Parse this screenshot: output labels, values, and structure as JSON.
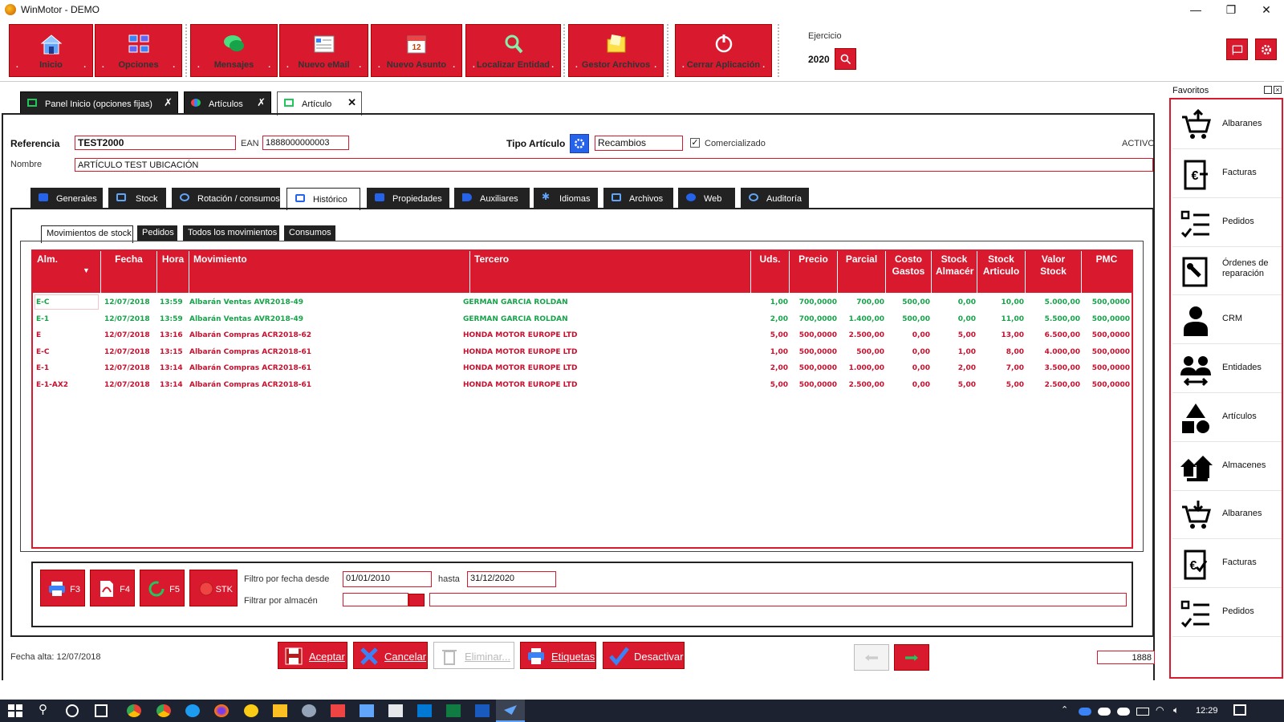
{
  "window": {
    "title": "WinMotor - DEMO",
    "min": "—",
    "max": "❐",
    "close": "✕"
  },
  "toolbar": {
    "buttons": [
      "Inicio",
      "Opciones",
      "Mensajes",
      "Nuevo eMail",
      "Nuevo Asunto",
      "Localizar Entidad",
      "Gestor Archivos",
      "Cerrar Aplicación"
    ]
  },
  "ejercicio": {
    "label": "Ejercicio",
    "value": "2020"
  },
  "favoritos": {
    "title": "Favoritos",
    "items": [
      "Albaranes",
      "Facturas",
      "Pedidos",
      "Órdenes de reparación",
      "CRM",
      "Entidades",
      "Artículos",
      "Almacenes",
      "Albaranes",
      "Facturas",
      "Pedidos"
    ]
  },
  "doc_tabs": [
    {
      "label": "Panel Inicio (opciones fijas)",
      "close": "✗"
    },
    {
      "label": "Artículos",
      "close": "✗"
    },
    {
      "label": "Artículo",
      "close": "✕"
    }
  ],
  "header": {
    "referencia_label": "Referencia",
    "referencia": "TEST2000",
    "ean_label": "EAN",
    "ean": "1888000000003",
    "tipo_label": "Tipo Artículo",
    "tipo": "Recambios",
    "comercializado_label": "Comercializado",
    "comercializado_mark": "✓",
    "estado": "ACTIVO",
    "nombre_label": "Nombre",
    "nombre": "ARTÍCULO TEST UBICACIÓN"
  },
  "sections": [
    "Generales",
    "Stock",
    "Rotación / consumos",
    "Histórico",
    "Propiedades",
    "Auxiliares",
    "Idiomas",
    "Archivos",
    "Web",
    "Auditoría"
  ],
  "hist_tabs": [
    "Movimientos de stock",
    "Pedidos",
    "Todos los movimientos",
    "Consumos"
  ],
  "grid": {
    "columns": [
      "Alm.",
      "Fecha",
      "Hora",
      "Movimiento",
      "Tercero",
      "Uds.",
      "Precio",
      "Parcial",
      "Costo Gastos",
      "Stock Almacér",
      "Stock Articulo",
      "Valor Stock",
      "PMC"
    ],
    "rows": [
      {
        "alm": "E-C",
        "fecha": "12/07/2018",
        "hora": "13:59",
        "mov": "Albarán Ventas AVR2018-49",
        "tercero": "GERMAN GARCIA ROLDAN",
        "uds": "1,00",
        "precio": "700,0000",
        "parcial": "700,00",
        "costo": "500,00",
        "salm": "0,00",
        "sart": "10,00",
        "valor": "5.000,00",
        "pmc": "500,0000",
        "color": "green"
      },
      {
        "alm": "E-1",
        "fecha": "12/07/2018",
        "hora": "13:59",
        "mov": "Albarán Ventas AVR2018-49",
        "tercero": "GERMAN GARCIA ROLDAN",
        "uds": "2,00",
        "precio": "700,0000",
        "parcial": "1.400,00",
        "costo": "500,00",
        "salm": "0,00",
        "sart": "11,00",
        "valor": "5.500,00",
        "pmc": "500,0000",
        "color": "green"
      },
      {
        "alm": "E",
        "fecha": "12/07/2018",
        "hora": "13:16",
        "mov": "Albarán Compras ACR2018-62",
        "tercero": "HONDA MOTOR EUROPE LTD",
        "uds": "5,00",
        "precio": "500,0000",
        "parcial": "2.500,00",
        "costo": "0,00",
        "salm": "5,00",
        "sart": "13,00",
        "valor": "6.500,00",
        "pmc": "500,0000",
        "color": "red"
      },
      {
        "alm": "E-C",
        "fecha": "12/07/2018",
        "hora": "13:15",
        "mov": "Albarán Compras ACR2018-61",
        "tercero": "HONDA MOTOR EUROPE LTD",
        "uds": "1,00",
        "precio": "500,0000",
        "parcial": "500,00",
        "costo": "0,00",
        "salm": "1,00",
        "sart": "8,00",
        "valor": "4.000,00",
        "pmc": "500,0000",
        "color": "red"
      },
      {
        "alm": "E-1",
        "fecha": "12/07/2018",
        "hora": "13:14",
        "mov": "Albarán Compras ACR2018-61",
        "tercero": "HONDA MOTOR EUROPE LTD",
        "uds": "2,00",
        "precio": "500,0000",
        "parcial": "1.000,00",
        "costo": "0,00",
        "salm": "2,00",
        "sart": "7,00",
        "valor": "3.500,00",
        "pmc": "500,0000",
        "color": "red"
      },
      {
        "alm": "E-1-AX2",
        "fecha": "12/07/2018",
        "hora": "13:14",
        "mov": "Albarán Compras ACR2018-61",
        "tercero": "HONDA MOTOR EUROPE LTD",
        "uds": "5,00",
        "precio": "500,0000",
        "parcial": "2.500,00",
        "costo": "0,00",
        "salm": "5,00",
        "sart": "5,00",
        "valor": "2.500,00",
        "pmc": "500,0000",
        "color": "red"
      }
    ]
  },
  "filters": {
    "buttons": [
      "F3",
      "F4",
      "F5",
      "STK"
    ],
    "fecha_desde_label": "Filtro por fecha desde",
    "fecha_desde": "01/01/2010",
    "hasta_label": "hasta",
    "hasta": "31/12/2020",
    "almacen_label": "Filtrar por almacén",
    "almacen": ""
  },
  "footer": {
    "fecha_alta": "Fecha alta: 12/07/2018",
    "aceptar": "Aceptar",
    "cancelar": "Cancelar",
    "eliminar": "Eliminar...",
    "etiquetas": "Etiquetas",
    "desactivar": "Desactivar",
    "counter": "1888"
  },
  "taskbar": {
    "time": "12:29"
  }
}
